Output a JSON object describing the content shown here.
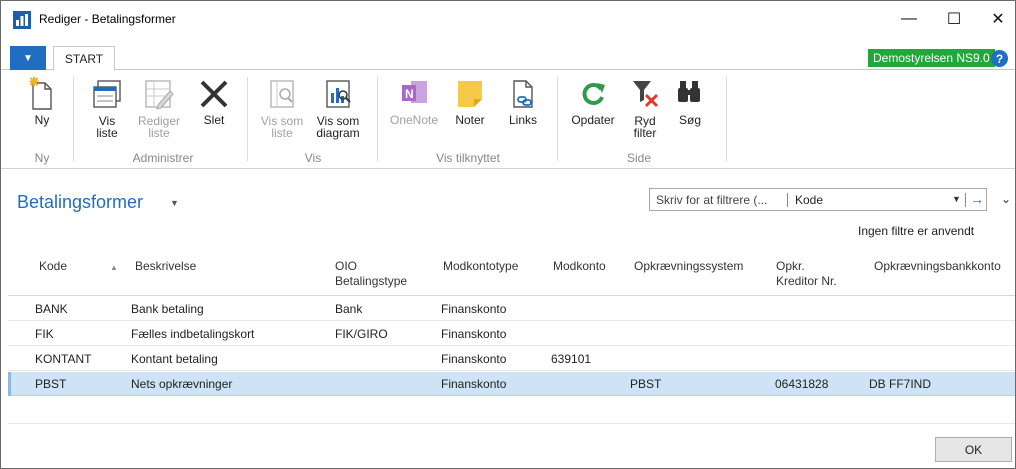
{
  "window": {
    "title": "Rediger - Betalingsformer",
    "minimize": "—",
    "maximize": "☐",
    "close": "✕"
  },
  "tabs": {
    "file": "▼",
    "start": "START"
  },
  "company": "Demostyrelsen NS9.0",
  "help": "?",
  "ribbon": {
    "ny": "Ny",
    "vis_liste": "Vis\nliste",
    "rediger_liste": "Rediger\nliste",
    "slet": "Slet",
    "vis_som_liste": "Vis som\nliste",
    "vis_som_diagram": "Vis som\ndiagram",
    "onenote": "OneNote",
    "noter": "Noter",
    "links": "Links",
    "opdater": "Opdater",
    "ryd_filter": "Ryd\nfilter",
    "sog": "Søg",
    "groups": {
      "ny": "Ny",
      "administrer": "Administrer",
      "vis": "Vis",
      "vis_tilknyttet": "Vis tilknyttet",
      "side": "Side"
    }
  },
  "page": {
    "title": "Betalingsformer",
    "filter_placeholder": "Skriv for at filtrere (...",
    "filter_field": "Kode",
    "no_filters": "Ingen filtre er anvendt"
  },
  "table": {
    "headers": {
      "kode": "Kode",
      "beskrivelse": "Beskrivelse",
      "oio_line1": "OIO",
      "oio_line2": "Betalingstype",
      "modkontotype": "Modkontotype",
      "modkonto": "Modkonto",
      "opkraevningssystem": "Opkrævningssystem",
      "kreditor_line1": "Opkr.",
      "kreditor_line2": "Kreditor Nr.",
      "bankkonto": "Opkrævningsbankkonto"
    },
    "rows": [
      {
        "kode": "BANK",
        "beskrivelse": "Bank betaling",
        "oio": "Bank",
        "modkontotype": "Finanskonto",
        "modkonto": "",
        "system": "",
        "kreditor": "",
        "bankkonto": ""
      },
      {
        "kode": "FIK",
        "beskrivelse": "Fælles indbetalingskort",
        "oio": "FIK/GIRO",
        "modkontotype": "Finanskonto",
        "modkonto": "",
        "system": "",
        "kreditor": "",
        "bankkonto": ""
      },
      {
        "kode": "KONTANT",
        "beskrivelse": "Kontant betaling",
        "oio": "",
        "modkontotype": "Finanskonto",
        "modkonto": "639101",
        "system": "",
        "kreditor": "",
        "bankkonto": ""
      },
      {
        "kode": "PBST",
        "beskrivelse": "Nets opkrævninger",
        "oio": "",
        "modkontotype": "Finanskonto",
        "modkonto": "",
        "system": "PBST",
        "kreditor": "06431828",
        "bankkonto": "DB FF7IND"
      }
    ]
  },
  "buttons": {
    "ok": "OK"
  },
  "colors": {
    "accent": "#1f6ec2",
    "company_badge": "#20a83a",
    "selected_row": "#cfe3f7"
  }
}
